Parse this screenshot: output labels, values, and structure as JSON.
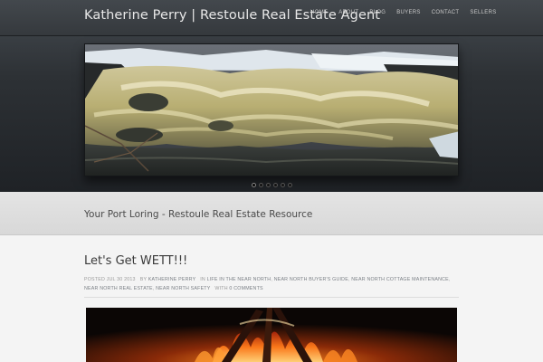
{
  "header": {
    "site_title": "Katherine Perry | Restoule Real Estate Agent",
    "nav": [
      "HOME",
      "ABOUT",
      "BLOG",
      "BUYERS",
      "CONTACT",
      "SELLERS"
    ]
  },
  "slider": {
    "image": "river-rapids-photo",
    "dots_count": 6,
    "active_dot": 1
  },
  "tagline": "Your Port Loring - Restoule Real Estate Resource",
  "post": {
    "title": "Let's Get WETT!!!",
    "posted_label": "Posted",
    "date": "JUL 30 2013",
    "by_label": "by",
    "author": "KATHERINE PERRY",
    "in_label": "in",
    "categories": [
      "LIFE IN THE NEAR NORTH",
      "NEAR NORTH BUYER'S GUIDE",
      "NEAR NORTH COTTAGE MAINTENANCE",
      "NEAR NORTH REAL ESTATE",
      "NEAR NORTH SAFETY"
    ],
    "with_label": "with",
    "comments": "0 COMMENTS",
    "image": "campfire-photo"
  },
  "colors": {
    "header_bg": "#3a3f44",
    "tagline_bg": "#dedede",
    "content_bg": "#f4f4f4",
    "link_gray": "#7a7f85"
  }
}
